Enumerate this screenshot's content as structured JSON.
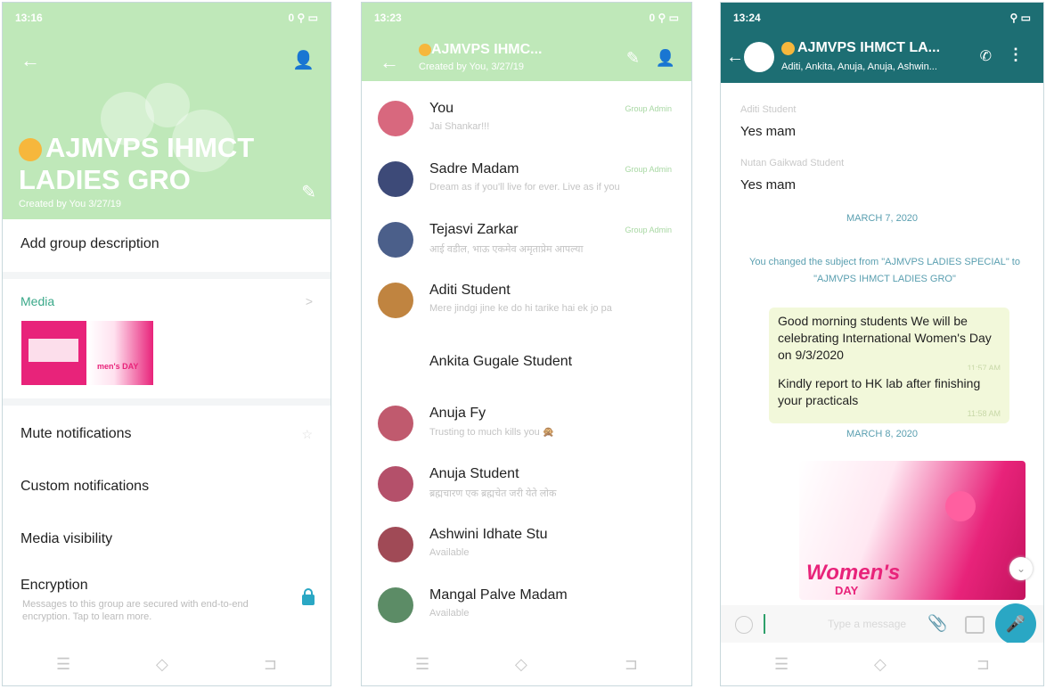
{
  "screen1": {
    "status_time": "13:16",
    "status_right": "0 ⚲ ▭",
    "group_name": "AJMVPS IHMCT LADIES GRO",
    "created_by": "Created by You 3/27/19",
    "add_description": "Add group description",
    "media_label": "Media",
    "media_arrow": ">",
    "thumb2_label": "men's DAY",
    "mute": "Mute notifications",
    "custom": "Custom notifications",
    "media_visibility": "Media visibility",
    "encryption": "Encryption",
    "encryption_sub": "Messages to this group are secured with end-to-end encryption. Tap to learn more."
  },
  "screen2": {
    "status_time": "13:23",
    "status_right": "0 ⚲ ▭",
    "title": "AJMVPS IHMC...",
    "subtitle": "Created by You, 3/27/19",
    "members": [
      {
        "name": "You",
        "status": "Jai Shankar!!!",
        "admin": "Group Admin",
        "color": "#d8687e"
      },
      {
        "name": "Sadre Madam",
        "status": "Dream as if you'll live for ever. Live as if you",
        "admin": "Group Admin",
        "color": "#3d4a78"
      },
      {
        "name": "Tejasvi Zarkar",
        "status": "आई वडील, भाऊ एकमेव अमृताप्रेम आपल्या",
        "admin": "Group Admin",
        "color": "#4b5f8a"
      },
      {
        "name": "Aditi Student",
        "status": "Mere jindgi jine ke do hi tarike hai ek jo pa",
        "admin": "",
        "color": "#c08440"
      },
      {
        "name": "Ankita Gugale Student",
        "status": "",
        "admin": "",
        "color": ""
      },
      {
        "name": "Anuja Fy",
        "status": "Trusting to much kills you 🙊",
        "admin": "",
        "color": "#c05a6e"
      },
      {
        "name": "Anuja Student",
        "status": "ब्रह्मचारण एक ब्रह्मचेत जरी येते लोक",
        "admin": "",
        "color": "#b4506a"
      },
      {
        "name": "Ashwini Idhate Stu",
        "status": "Available",
        "admin": "",
        "color": "#a04a56"
      },
      {
        "name": "Mangal Palve Madam",
        "status": "Available",
        "admin": "",
        "color": "#5c8c66"
      }
    ]
  },
  "screen3": {
    "status_time": "13:24",
    "status_right": "⚲ ▭",
    "title": "AJMVPS IHMCT LA...",
    "subtitle": "Aditi, Ankita, Anuja, Anuja, Ashwin...",
    "msg1_sender": "Aditi Student",
    "msg1_text": "Yes mam",
    "msg2_sender": "Nutan Gaikwad Student",
    "msg2_text": "Yes mam",
    "date1": "MARCH 7, 2020",
    "system_message": "You changed the subject from \"AJMVPS LADIES SPECIAL\" to \"AJMVPS IHMCT LADIES GRO\"",
    "bubble1_text": "Good morning students We will be celebrating International Women's Day on 9/3/2020",
    "bubble1_time": "11:57 AM",
    "bubble2_text": "Kindly report to HK lab after finishing your practicals",
    "bubble2_time": "11:58 AM",
    "date2": "MARCH 8, 2020",
    "image_text1": "Women's",
    "image_text2": "DAY",
    "composer_placeholder": "Type a message"
  }
}
